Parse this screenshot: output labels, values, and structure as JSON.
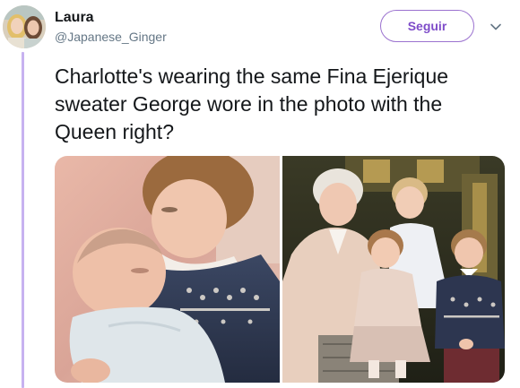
{
  "tweet": {
    "author_name": "Laura",
    "author_handle": "@Japanese_Ginger",
    "follow_label": "Seguir",
    "text": "Charlotte's wearing the same Fina Ejerique sweater George wore in the photo with the Queen right?"
  },
  "icons": {
    "caret": "chevron-down-icon",
    "avatar": "profile-photo"
  },
  "colors": {
    "accent": "#7e4cc9",
    "thread_line": "#c7b2f0",
    "text": "#14171a",
    "secondary_text": "#657786"
  }
}
